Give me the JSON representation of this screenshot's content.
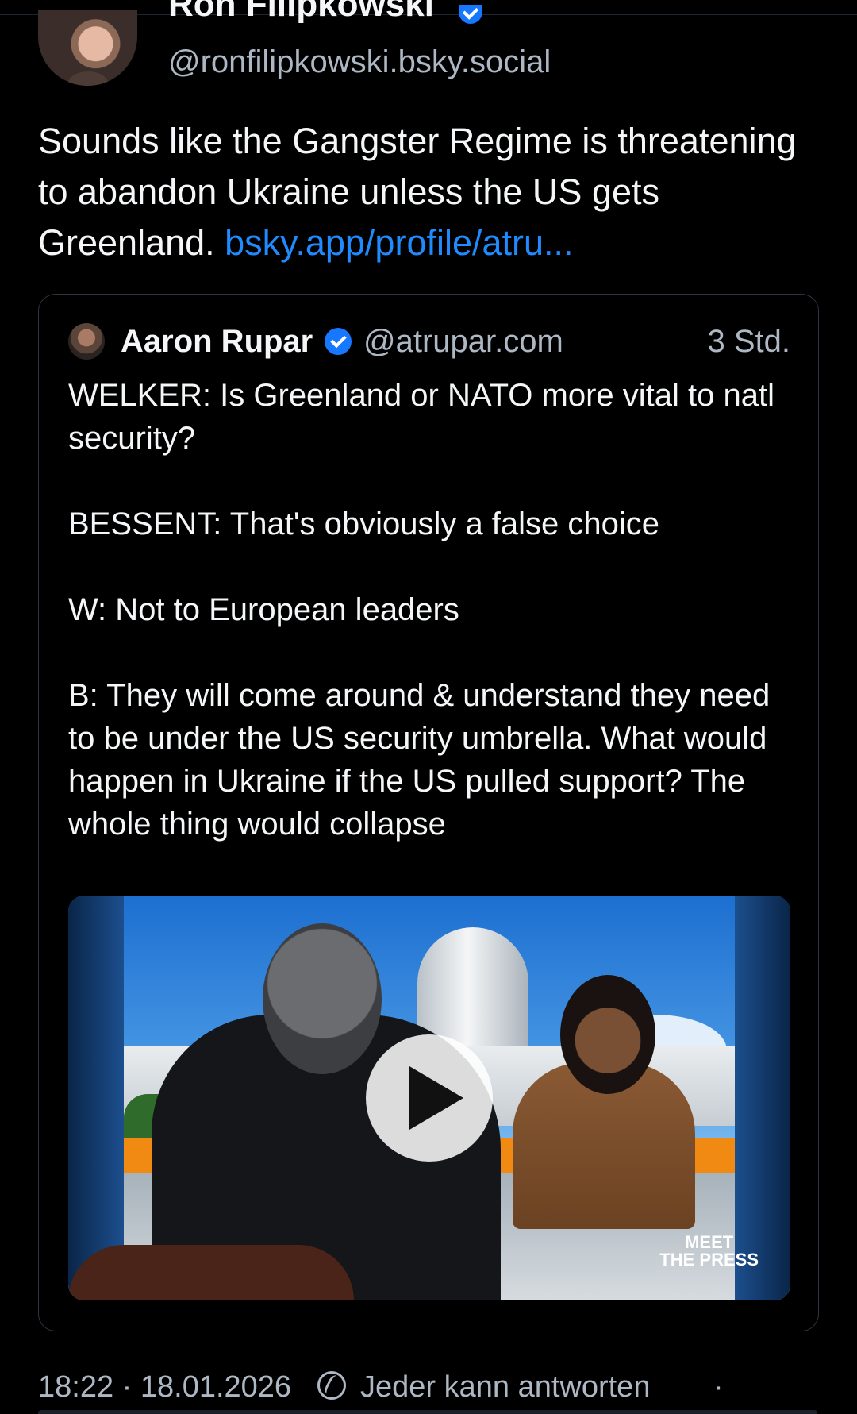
{
  "post": {
    "author_name": "Ron Filipkowski",
    "author_handle": "@ronfilipkowski.bsky.social",
    "text": "Sounds like the Gangster Regime is threatening to abandon Ukraine unless the US gets Greenland. ",
    "link_text": "bsky.app/profile/atru..."
  },
  "quote": {
    "author_name": "Aaron Rupar",
    "author_handle": "@atrupar.com",
    "time": "3 Std.",
    "text": "WELKER: Is Greenland or NATO more vital to natl security?\n\nBESSENT: That's obviously a false choice\n\nW: Not to European leaders\n\nB: They will come around & understand they need to be under the US security umbrella. What would happen in Ukraine if the US pulled support? The whole thing would collapse",
    "video_logo_line1": "MEET",
    "video_logo_line2": "THE PRESS"
  },
  "footer": {
    "datetime": "18:22 · 18.01.2026",
    "reply_setting": "Jeder kann antworten",
    "separator": "·"
  },
  "colors": {
    "background": "#000000",
    "link": "#208bfe",
    "verified": "#1677ff",
    "muted_text": "#aeb8c4"
  }
}
